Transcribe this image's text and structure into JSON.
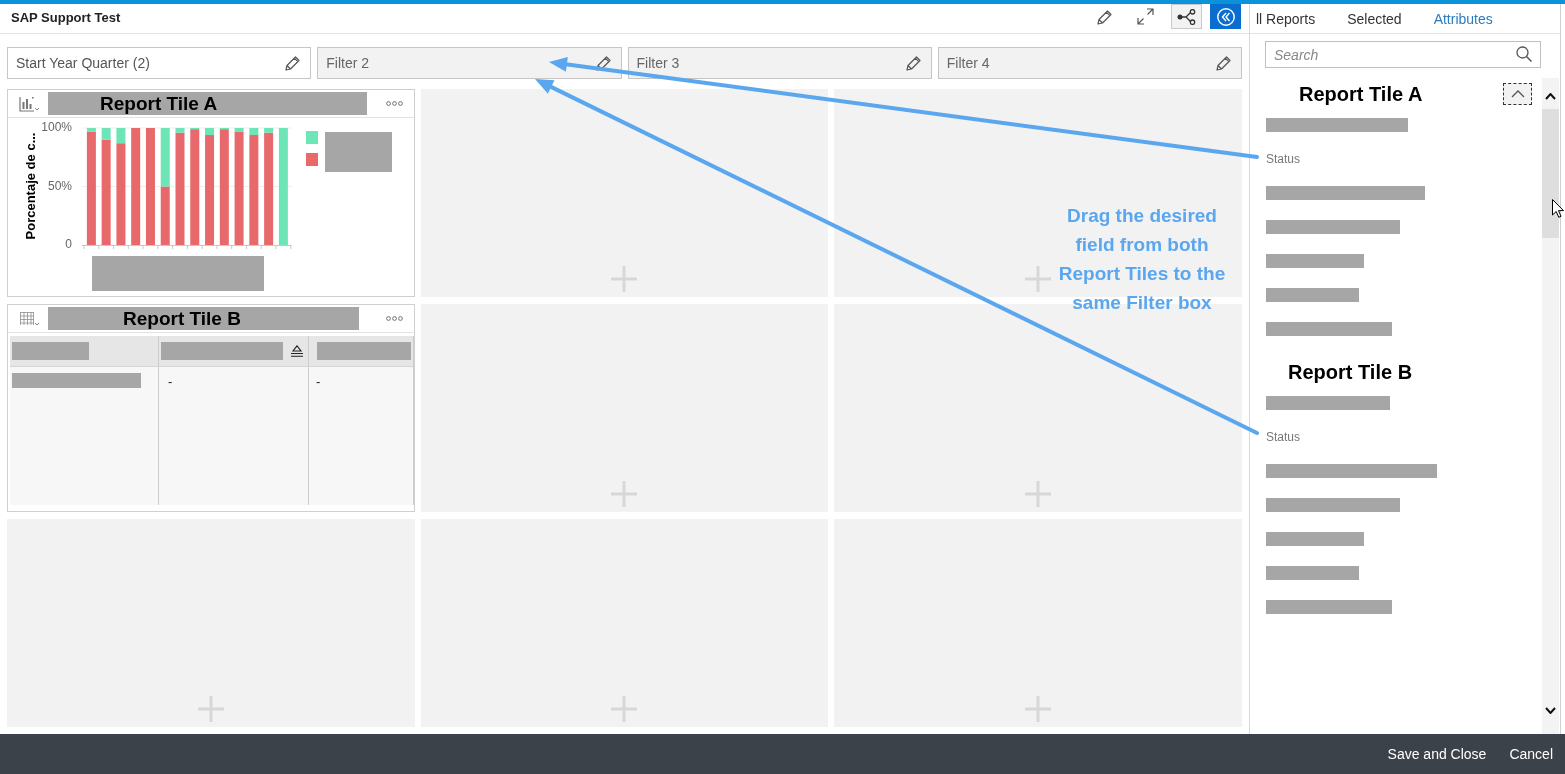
{
  "window": {
    "title": "SAP Support Test"
  },
  "filters": [
    {
      "label": "Start Year Quarter (2)",
      "assigned": true
    },
    {
      "label": "Filter 2",
      "assigned": false
    },
    {
      "label": "Filter 3",
      "assigned": false
    },
    {
      "label": "Filter 4",
      "assigned": false
    }
  ],
  "tiles": [
    {
      "kind": "chart",
      "title": "Report Tile A",
      "chart_data": {
        "type": "bar",
        "ylabel": "Porcentaje de c...",
        "stacked": true,
        "ylim": [
          0,
          100
        ],
        "yticks": [
          {
            "value": 0,
            "label": "0"
          },
          {
            "value": 50,
            "label": "50%"
          },
          {
            "value": 100,
            "label": "100%"
          }
        ],
        "series": [
          {
            "color": "#e8696b",
            "values": [
              97,
              90,
              87,
              100,
              100,
              50,
              96,
              99,
              94,
              99,
              97,
              94,
              96,
              0
            ]
          },
          {
            "color": "#6de5b6",
            "values": [
              3,
              10,
              13,
              0,
              0,
              50,
              4,
              1,
              6,
              1,
              3,
              6,
              4,
              100
            ]
          }
        ]
      }
    },
    {
      "kind": "empty"
    },
    {
      "kind": "empty"
    },
    {
      "kind": "table",
      "title": "Report Tile B",
      "table": {
        "columns": [
          {
            "sorted": false
          },
          {
            "sorted": true
          },
          {
            "sorted": false
          }
        ],
        "rows": [
          {
            "cells": [
              {
                "kind": "redacted"
              },
              {
                "kind": "text",
                "text": "-"
              },
              {
                "kind": "text",
                "text": "-"
              }
            ]
          }
        ]
      }
    },
    {
      "kind": "empty"
    },
    {
      "kind": "empty"
    },
    {
      "kind": "empty"
    },
    {
      "kind": "empty"
    },
    {
      "kind": "empty"
    }
  ],
  "sidebar": {
    "tabs": [
      {
        "label": "ll Reports",
        "selected": false
      },
      {
        "label": "Selected",
        "selected": false
      },
      {
        "label": "Attributes",
        "selected": true
      }
    ],
    "search": {
      "placeholder": "Search"
    },
    "groups": [
      {
        "title": "Report Tile A",
        "toggle": {
          "focused": true,
          "expanded": true
        },
        "items": [
          {
            "kind": "redacted"
          },
          {
            "kind": "field",
            "label": "Status"
          },
          {
            "kind": "redacted"
          },
          {
            "kind": "redacted"
          },
          {
            "kind": "redacted"
          },
          {
            "kind": "redacted"
          },
          {
            "kind": "redacted"
          }
        ]
      },
      {
        "title": "Report Tile B",
        "items": [
          {
            "kind": "redacted"
          },
          {
            "kind": "field",
            "label": "Status"
          },
          {
            "kind": "redacted"
          },
          {
            "kind": "redacted"
          },
          {
            "kind": "redacted"
          },
          {
            "kind": "redacted"
          },
          {
            "kind": "redacted"
          }
        ]
      }
    ]
  },
  "annotation": {
    "text": "Drag the desired field from both Report Tiles to the same Filter box"
  },
  "footer": {
    "buttons": [
      {
        "label": "Save and Close"
      },
      {
        "label": "Cancel"
      }
    ]
  }
}
